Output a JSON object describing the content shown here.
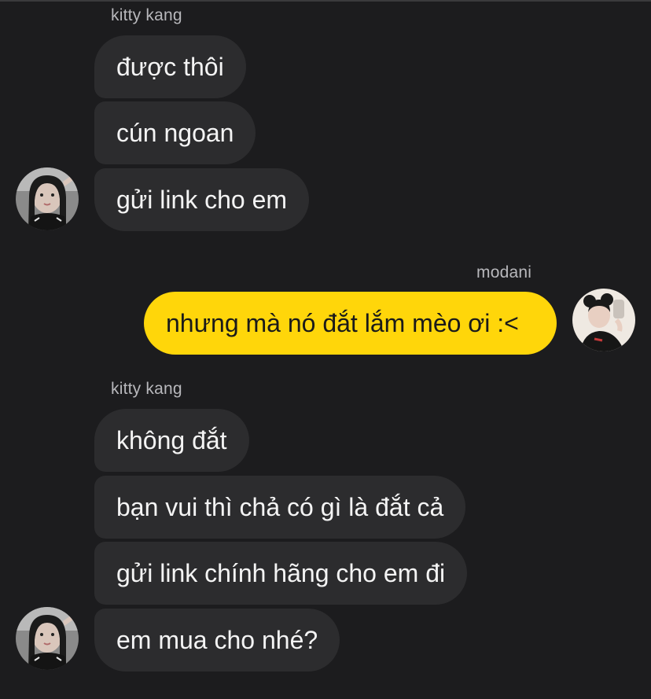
{
  "colors": {
    "background": "#1c1c1e",
    "incoming_bubble": "#2c2c2e",
    "outgoing_bubble": "#ffd60a",
    "sender_name": "#b8b8bc"
  },
  "conversation": {
    "group1": {
      "sender": "kitty kang",
      "messages": [
        "được thôi",
        "cún ngoan",
        "gửi link cho em"
      ],
      "avatar_icon": "kitty-kang-avatar"
    },
    "group2": {
      "sender": "modani",
      "messages": [
        "nhưng mà nó đắt lắm mèo ơi :<"
      ],
      "avatar_icon": "modani-avatar"
    },
    "group3": {
      "sender": "kitty kang",
      "messages": [
        "không đắt",
        "bạn vui thì chả có gì là đắt cả",
        "gửi link chính hãng cho em đi",
        "em mua cho nhé?"
      ],
      "avatar_icon": "kitty-kang-avatar"
    }
  }
}
